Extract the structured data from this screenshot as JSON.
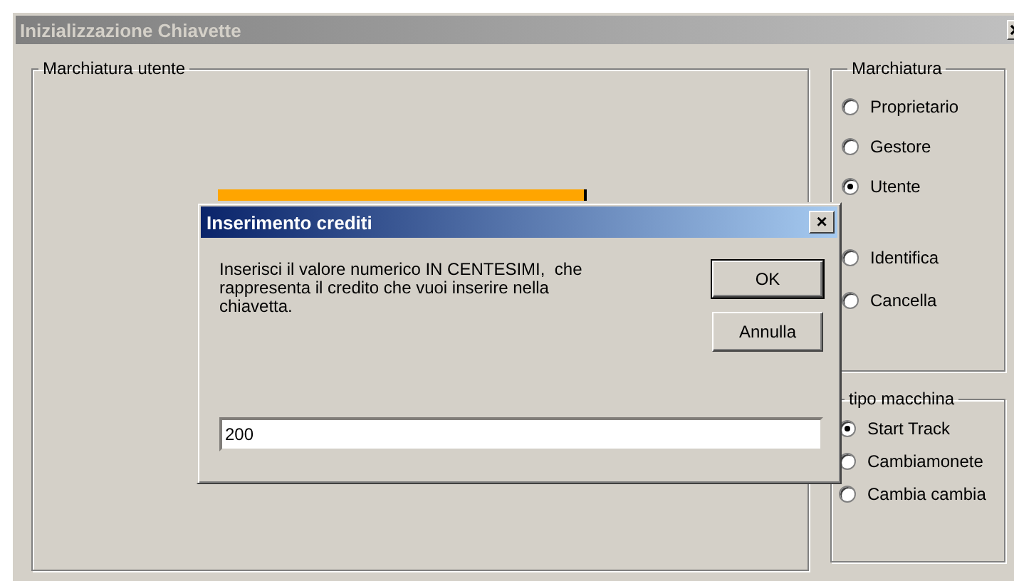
{
  "window": {
    "title": "Inizializzazione Chiavette"
  },
  "left_group": {
    "title": "Marchiatura utente"
  },
  "marchiatura": {
    "title": "Marchiatura",
    "options": [
      {
        "label": "Proprietario",
        "selected": false
      },
      {
        "label": "Gestore",
        "selected": false
      },
      {
        "label": "Utente",
        "selected": true
      }
    ],
    "actions": [
      {
        "label": "Identifica",
        "selected": false
      },
      {
        "label": "Cancella",
        "selected": false
      }
    ]
  },
  "machine_type": {
    "title": "tipo macchina",
    "options": [
      {
        "label": "Start Track",
        "selected": true
      },
      {
        "label": "Cambiamonete",
        "selected": false
      },
      {
        "label": "Cambia cambia",
        "selected": false
      }
    ]
  },
  "dialog": {
    "title": "Inserimento crediti",
    "close": "×",
    "message": "Inserisci il valore numerico IN CENTESIMI,  che rappresenta il credito che vuoi inserire nella chiavetta.",
    "buttons": [
      {
        "label": "OK",
        "default": true
      },
      {
        "label": "Annulla",
        "default": false
      }
    ],
    "value": "200"
  }
}
